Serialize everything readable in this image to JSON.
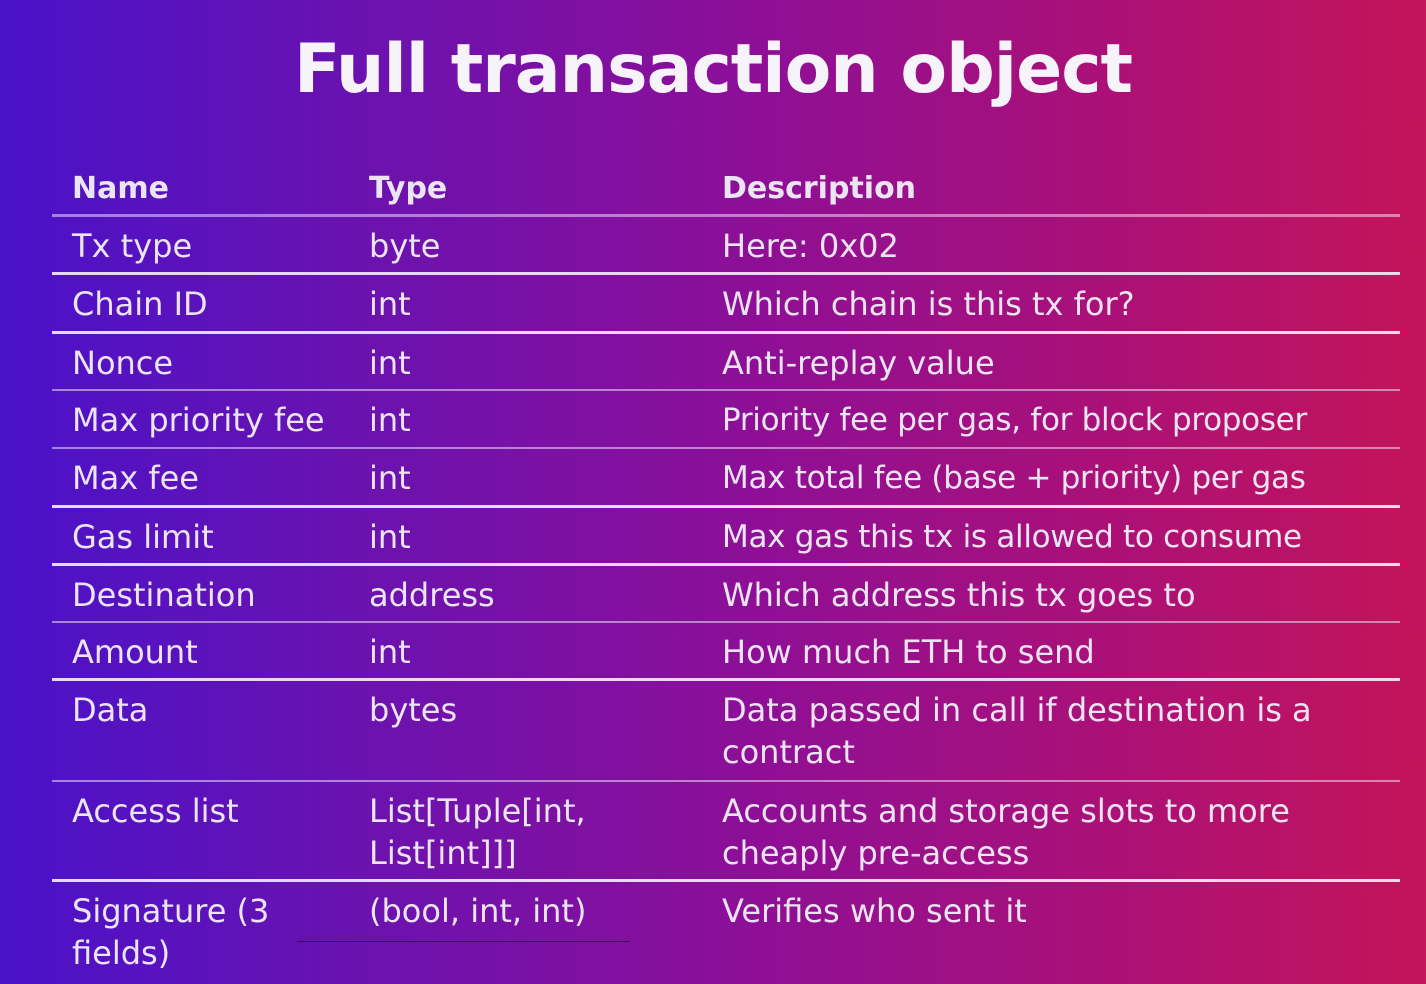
{
  "title": "Full transaction object",
  "table": {
    "headers": {
      "name": "Name",
      "type": "Type",
      "description": "Description"
    },
    "rows": [
      {
        "name": "Tx type",
        "type": "byte",
        "description": "Here: 0x02"
      },
      {
        "name": "Chain ID",
        "type": "int",
        "description": "Which chain is this tx for?"
      },
      {
        "name": "Nonce",
        "type": "int",
        "description": "Anti-replay value"
      },
      {
        "name": "Max priority fee",
        "type": "int",
        "description": "Priority fee per gas, for block proposer"
      },
      {
        "name": "Max fee",
        "type": "int",
        "description": "Max total fee (base + priority) per gas"
      },
      {
        "name": "Gas limit",
        "type": "int",
        "description": "Max gas this tx is allowed to consume"
      },
      {
        "name": "Destination",
        "type": "address",
        "description": "Which address this tx goes to"
      },
      {
        "name": "Amount",
        "type": "int",
        "description": "How much ETH to send"
      },
      {
        "name": "Data",
        "type": "bytes",
        "description": "Data passed in call if destination is a contract"
      },
      {
        "name": "Access list",
        "type": "List[Tuple[int, List[int]]]",
        "description": "Accounts and storage slots to more cheaply pre-access"
      },
      {
        "name": "Signature (3 fields)",
        "type": "(bool, int, int)",
        "description": "Verifies who sent it"
      }
    ]
  },
  "colors": {
    "gradient_left": "#4a12c9",
    "gradient_mid": "#8a0f9a",
    "gradient_right": "#c4145a",
    "text": "#ebe4f3"
  }
}
